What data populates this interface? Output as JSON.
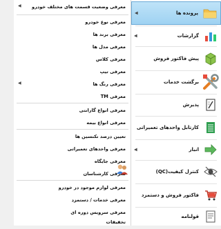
{
  "sidebar": {
    "items": [
      {
        "label": "پرونده ها",
        "icon": "folder-icon",
        "has_submenu": true
      },
      {
        "label": "گزارشات",
        "icon": "reports-icon",
        "has_submenu": true
      },
      {
        "label": "پیش فاکتور فروش",
        "icon": "pre-invoice-icon",
        "has_submenu": false
      },
      {
        "label": "برگشت خدمات",
        "icon": "service-return-icon",
        "has_submenu": false
      },
      {
        "label": "پذیرش",
        "icon": "reception-icon",
        "has_submenu": false
      },
      {
        "label": "کارتابل واحدهای تعمیراتی",
        "icon": "workshop-cartable-icon",
        "has_submenu": false
      },
      {
        "label": "انبار",
        "icon": "warehouse-icon",
        "has_submenu": true
      },
      {
        "label": "کنترل کیفیت(QC)",
        "icon": "quality-control-icon",
        "has_submenu": false
      },
      {
        "label": "فاکتور فروش و دستمزد",
        "icon": "sales-invoice-icon",
        "has_submenu": false
      },
      {
        "label": "قولنامه",
        "icon": "contract-icon",
        "has_submenu": false
      }
    ]
  },
  "submenu": {
    "items": [
      {
        "label": "معرفی وضعیت قسمت های مختلف خودرو",
        "has_submenu": true
      },
      {
        "label": "معرفی نوع خودرو",
        "has_submenu": false
      },
      {
        "label": "معرفی برند ها",
        "has_submenu": false
      },
      {
        "label": "معرفی مدل ها",
        "has_submenu": false
      },
      {
        "label": "معرفی کلاس",
        "has_submenu": false
      },
      {
        "label": "معرفی تیپ",
        "has_submenu": false
      },
      {
        "label": "معرفی رنگ ها",
        "has_submenu": true
      },
      {
        "label": "معرفی TM",
        "has_submenu": false
      },
      {
        "label": "معرفی انواع گارانتی",
        "has_submenu": false
      },
      {
        "label": "معرفی انواع بیمه",
        "has_submenu": false
      },
      {
        "label": "تعیین درصد تکنسین ها",
        "has_submenu": false
      },
      {
        "label": "معرفی واحدهای تعمیراتی",
        "has_submenu": false
      },
      {
        "label": "معرفی جایگاه",
        "has_submenu": false
      },
      {
        "label": "معرفی کارشناسان",
        "has_submenu": false
      },
      {
        "label": "معرفی لوازم موجود در خودرو",
        "has_submenu": false
      },
      {
        "label": "معرفی خدمات / دستمزد",
        "has_submenu": false
      },
      {
        "label": "معرفی سرویس دوره ای",
        "has_submenu": false
      },
      {
        "label": "تخفیفات",
        "has_submenu": false
      }
    ]
  },
  "colors": {
    "active_bg": "#aedaf5",
    "active_border": "#6aa9d6",
    "separator": "#d8d8d8"
  }
}
